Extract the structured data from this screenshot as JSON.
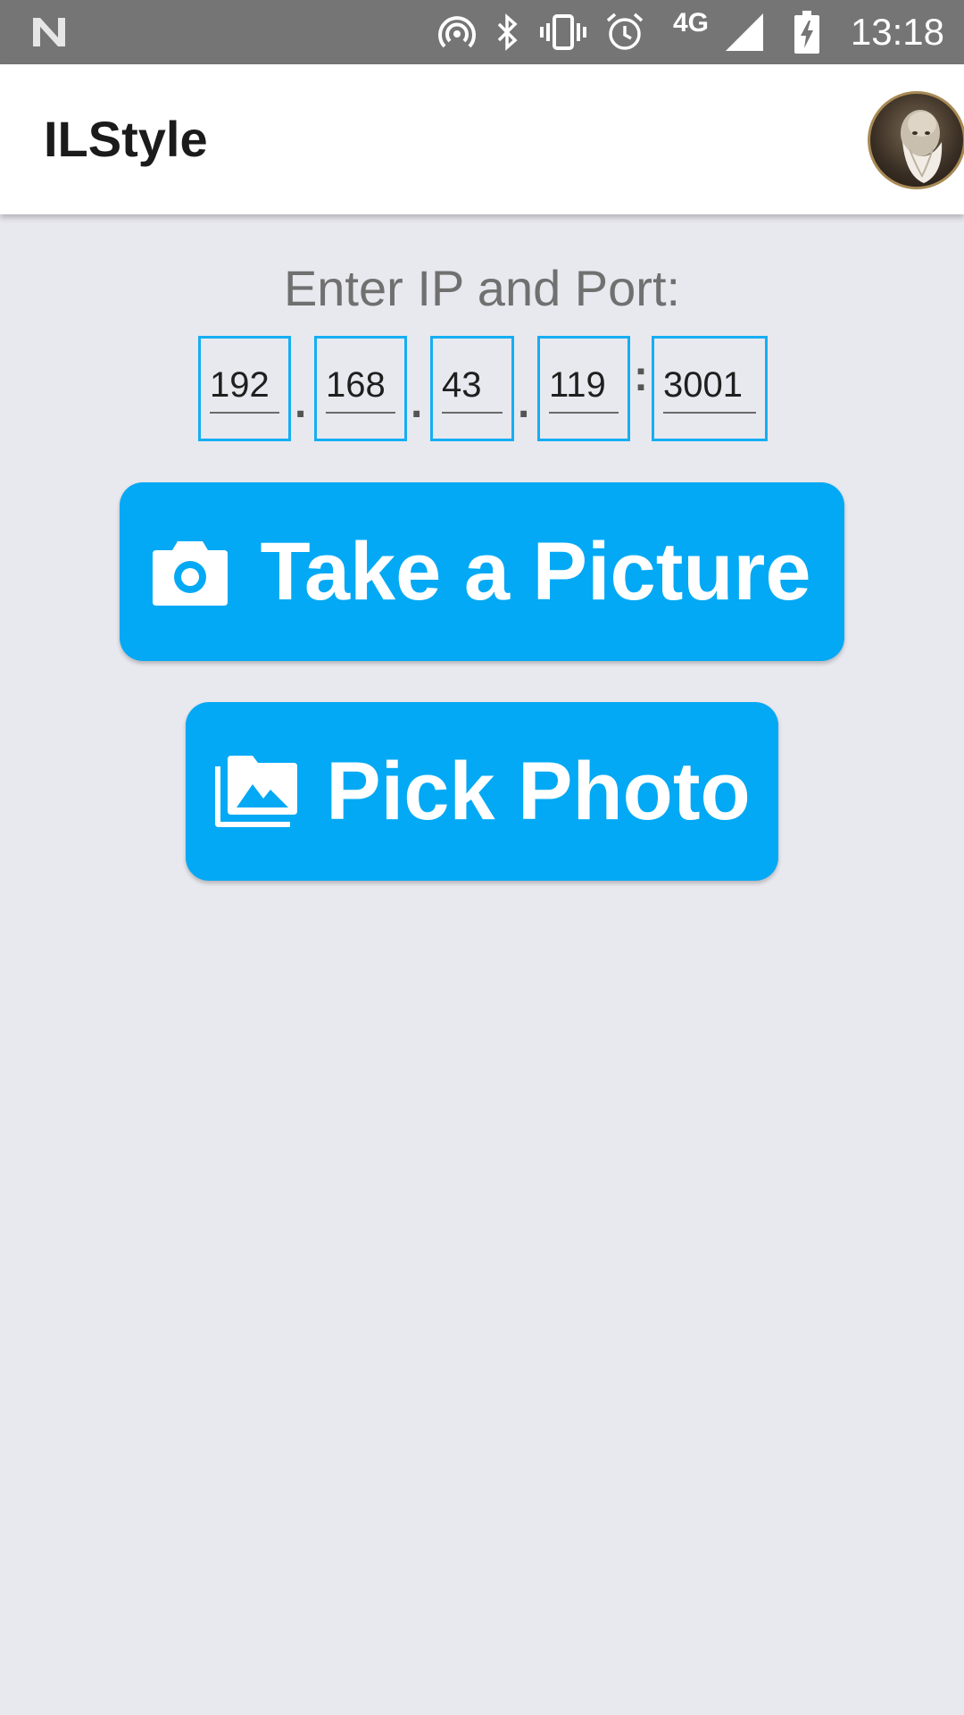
{
  "status_bar": {
    "time": "13:18",
    "network_label": "4G",
    "icons": [
      "n-logo-icon",
      "hotspot-icon",
      "bluetooth-icon",
      "vibrate-icon",
      "alarm-icon",
      "signal-icon",
      "battery-charging-icon"
    ]
  },
  "app_bar": {
    "title": "ILStyle",
    "avatar_icon": "avatar-bust-icon"
  },
  "connection": {
    "label": "Enter IP and Port:",
    "ip_octets": [
      "192",
      "168",
      "43",
      "119"
    ],
    "port": "3001",
    "separators": {
      "dot": ".",
      "colon": ":"
    }
  },
  "actions": {
    "take_picture": {
      "label": "Take a Picture",
      "icon": "camera-icon"
    },
    "pick_photo": {
      "label": "Pick Photo",
      "icon": "photo-library-icon"
    }
  },
  "colors": {
    "accent": "#03a9f4",
    "field_border": "#15aef2",
    "status_bar": "#757575",
    "background": "#e8e8ef"
  }
}
